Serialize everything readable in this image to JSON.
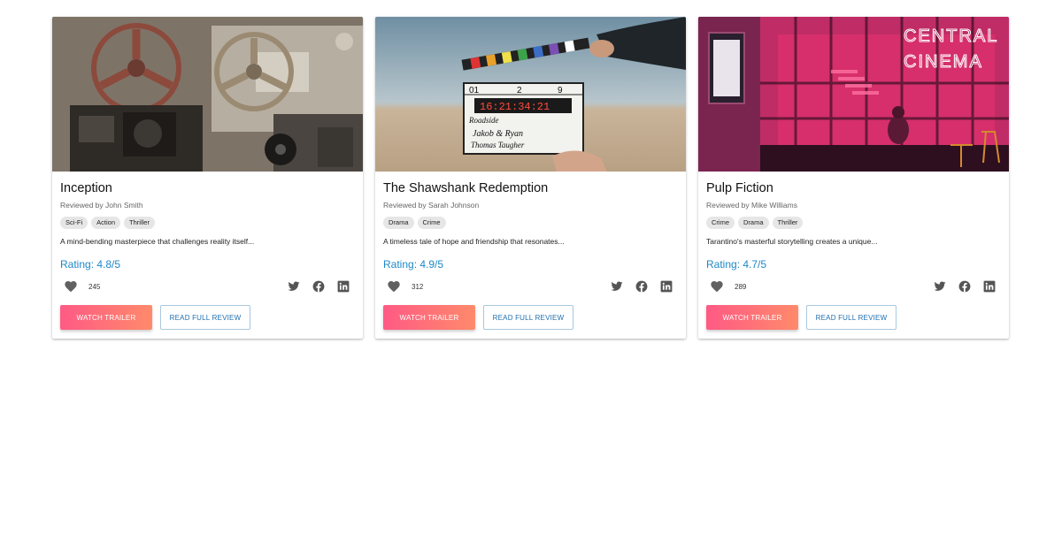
{
  "cards": [
    {
      "title": "Inception",
      "reviewer": "Reviewed by John Smith",
      "tags": [
        "Sci-Fi",
        "Action",
        "Thriller"
      ],
      "description": "A mind-bending masterpiece that challenges reality itself...",
      "rating": "Rating: 4.8/5",
      "likes": "245",
      "trailer_label": "WATCH TRAILER",
      "review_label": "READ FULL REVIEW",
      "image_icon": "film-reels-photo"
    },
    {
      "title": "The Shawshank Redemption",
      "reviewer": "Reviewed by Sarah Johnson",
      "tags": [
        "Drama",
        "Crime"
      ],
      "description": "A timeless tale of hope and friendship that resonates...",
      "rating": "Rating: 4.9/5",
      "likes": "312",
      "trailer_label": "WATCH TRAILER",
      "review_label": "READ FULL REVIEW",
      "image_icon": "clapperboard-photo",
      "clapper": {
        "scene": "01",
        "take": "2",
        "roll": "9",
        "timecode": "16:21:34:21",
        "line1": "Roadside",
        "line2": "Jakob & Ryan",
        "line3": "Thomas Taugher"
      }
    },
    {
      "title": "Pulp Fiction",
      "reviewer": "Reviewed by Mike Williams",
      "tags": [
        "Crime",
        "Drama",
        "Thriller"
      ],
      "description": "Tarantino's masterful storytelling creates a unique...",
      "rating": "Rating: 4.7/5",
      "likes": "289",
      "trailer_label": "WATCH TRAILER",
      "review_label": "READ FULL REVIEW",
      "image_icon": "cinema-neon-photo",
      "sign": {
        "line1": "CENTRAL",
        "line2": "CINEMA"
      }
    }
  ],
  "colors": {
    "accent_blue": "#1e88c7",
    "button_gradient_start": "#ff5a84",
    "button_gradient_end": "#ff8a6b"
  },
  "icons": [
    "heart-icon",
    "twitter-icon",
    "facebook-icon",
    "linkedin-icon"
  ]
}
